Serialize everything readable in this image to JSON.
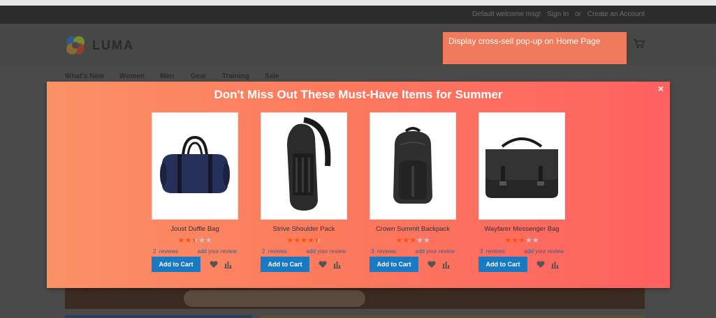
{
  "panel": {
    "welcome": "Default welcome msg!",
    "sign_in": "Sign In",
    "or": "or",
    "create_account": "Create an Account"
  },
  "header": {
    "logo_text": "LUMA",
    "annotation": "Display cross-sell pop-up on Home Page"
  },
  "nav": {
    "items": [
      "What's New",
      "Women",
      "Men",
      "Gear",
      "Training",
      "Sale"
    ]
  },
  "popup": {
    "title": "Don't Miss Out These Must-Have Items for Summer",
    "close": "×",
    "add_to_cart_label": "Add to Cart",
    "reviews_label": "reviews",
    "add_review_label": "add your review",
    "products": [
      {
        "name": "Joust Duffle Bag",
        "rating": 2.5,
        "reviews": "2"
      },
      {
        "name": "Strive Shoulder Pack",
        "rating": 4.5,
        "reviews": "2"
      },
      {
        "name": "Crown Summit Backpack",
        "rating": 3,
        "reviews": "3"
      },
      {
        "name": "Wayfarer Messenger Bag",
        "rating": 3,
        "reviews": "3"
      }
    ]
  },
  "colors": {
    "accent_button": "#1979c3",
    "star": "#ff5501",
    "popup_gradient_start": "#fb9266",
    "popup_gradient_end": "#ff6161"
  }
}
